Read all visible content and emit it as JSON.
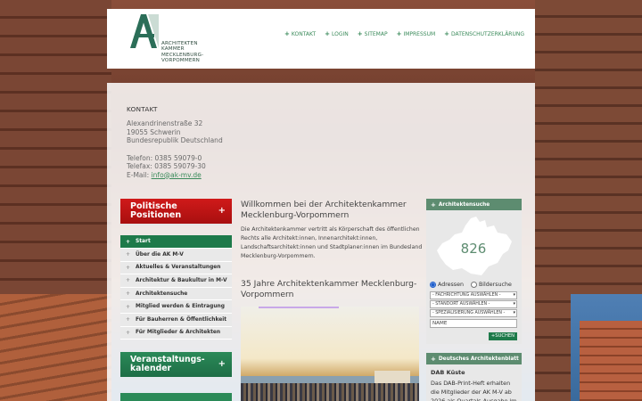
{
  "logo": {
    "lines": [
      "ARCHITEKTEN",
      "KAMMER",
      "MECKLENBURG-",
      "VORPOMMERN"
    ]
  },
  "topnav": [
    "KONTAKT",
    "LOGIN",
    "SITEMAP",
    "IMPRESSUM",
    "DATENSCHUTZERKLÄRUNG"
  ],
  "contact": {
    "title": "KONTAKT",
    "street": "Alexandrinenstraße 32",
    "city": "19055 Schwerin",
    "country": "Bundesrepublik Deutschland",
    "phone": "Telefon: 0385 59079-0",
    "fax": "Telefax: 0385 59079-30",
    "email_label": "E-Mail: ",
    "email": "info@ak-mv.de"
  },
  "banners": {
    "politische": [
      "Politische",
      "Positionen"
    ],
    "veranstaltung": [
      "Veranstaltungs-",
      "kalender"
    ]
  },
  "leftnav": [
    "Start",
    "Über die AK M-V",
    "Aktuelles & Veranstaltungen",
    "Architektur & Baukultur in M-V",
    "Architektensuche",
    "Mitglied werden & Eintragung",
    "Für Bauherren & Öffentlichkeit",
    "Für Mitglieder & Architekten"
  ],
  "main": {
    "welcome_title": "Willkommen bei der Architektenkammer Mecklenburg-Vorpommern",
    "welcome_text": "Die Architektenkammer vertritt als Körperschaft des öffentlichen Rechts alle Architekt:innen, Innenarchitekt:innen, Landschaftsarchitekt:innen und Stadtplaner:innen im Bundesland Mecklenburg-Vorpommern.",
    "jahre_title": "35 Jahre Architektenkammer Mecklenburg-Vorpommern"
  },
  "search": {
    "head": "Architektensuche",
    "count": "826",
    "radio_adressen": "Adressen",
    "radio_bildersuche": "Bildersuche",
    "select_fachrichtung": "- FACHRICHTUNG AUSWÄHLEN -",
    "select_standort": "- STANDORT AUSWÄHLEN -",
    "select_spezialisierung": "- SPEZIALISIERUNG AUSWÄHLEN -",
    "name_value": "NAME",
    "button": "SUCHEN"
  },
  "dab": {
    "head": "Deutsches Architektenblatt",
    "title": "DAB Küste",
    "text": "Das DAB-Print-Heft erhalten die Mitglieder der AK M-V ab 2026 als Quartals-Ausgabe im"
  },
  "colors": {
    "accent_green": "#1e7a4a",
    "side_green": "#5d8c70",
    "red": "#c01515"
  }
}
